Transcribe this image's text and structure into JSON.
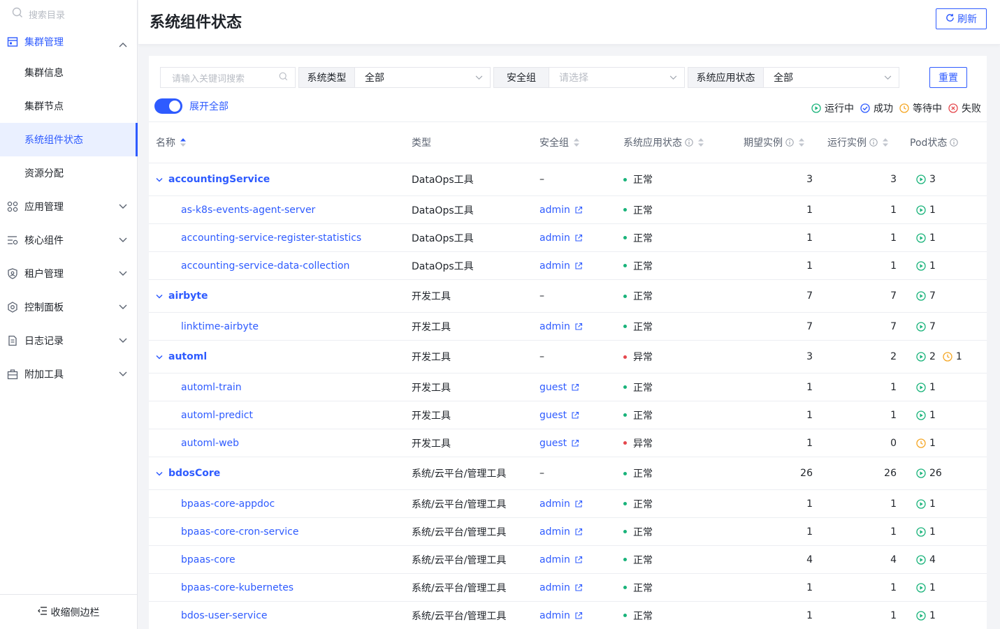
{
  "sidebar": {
    "search_placeholder": "搜索目录",
    "cluster_group": "集群管理",
    "sub_items": [
      "集群信息",
      "集群节点",
      "系统组件状态",
      "资源分配"
    ],
    "groups": [
      {
        "label": "应用管理",
        "icon": "apps-icon"
      },
      {
        "label": "核心组件",
        "icon": "core-components-icon"
      },
      {
        "label": "租户管理",
        "icon": "tenant-shield-icon"
      },
      {
        "label": "控制面板",
        "icon": "settings-gear-icon"
      },
      {
        "label": "日志记录",
        "icon": "log-document-icon"
      },
      {
        "label": "附加工具",
        "icon": "toolbox-icon"
      }
    ],
    "collapse_label": "收缩侧边栏"
  },
  "header": {
    "title": "系统组件状态",
    "refresh_label": "刷新"
  },
  "filters": {
    "keyword_placeholder": "请输入关键词搜索",
    "type_label": "系统类型",
    "type_value": "全部",
    "sg_label": "安全组",
    "sg_placeholder": "请选择",
    "status_label": "系统应用状态",
    "status_value": "全部",
    "reset_label": "重置",
    "expand_all_label": "展开全部"
  },
  "legend": {
    "running": "运行中",
    "success": "成功",
    "pending": "等待中",
    "failed": "失败"
  },
  "colors": {
    "accent": "#2e5bff",
    "running": "#19b37a",
    "success": "#2e5bff",
    "pending": "#f5a623",
    "failed": "#e5484d",
    "normal_dot": "#19b37a",
    "abnormal_dot": "#e5484d"
  },
  "table": {
    "columns": {
      "name": "名称",
      "type": "类型",
      "sg": "安全组",
      "status": "系统应用状态",
      "expected": "期望实例",
      "running": "运行实例",
      "pod": "Pod状态"
    },
    "rows": [
      {
        "kind": "parent",
        "name": "accountingService",
        "type": "DataOps工具",
        "sg": "–",
        "status": "正常",
        "ok": true,
        "expected": "3",
        "running": "3",
        "pods": [
          {
            "s": "running",
            "n": "3"
          }
        ]
      },
      {
        "kind": "child",
        "name": "as-k8s-events-agent-server",
        "type": "DataOps工具",
        "sg": "admin",
        "status": "正常",
        "ok": true,
        "expected": "1",
        "running": "1",
        "pods": [
          {
            "s": "running",
            "n": "1"
          }
        ]
      },
      {
        "kind": "child",
        "name": "accounting-service-register-statistics",
        "type": "DataOps工具",
        "sg": "admin",
        "status": "正常",
        "ok": true,
        "expected": "1",
        "running": "1",
        "pods": [
          {
            "s": "running",
            "n": "1"
          }
        ]
      },
      {
        "kind": "child",
        "name": "accounting-service-data-collection",
        "type": "DataOps工具",
        "sg": "admin",
        "status": "正常",
        "ok": true,
        "expected": "1",
        "running": "1",
        "pods": [
          {
            "s": "running",
            "n": "1"
          }
        ]
      },
      {
        "kind": "parent",
        "name": "airbyte",
        "type": "开发工具",
        "sg": "–",
        "status": "正常",
        "ok": true,
        "expected": "7",
        "running": "7",
        "pods": [
          {
            "s": "running",
            "n": "7"
          }
        ]
      },
      {
        "kind": "child",
        "name": "linktime-airbyte",
        "type": "开发工具",
        "sg": "admin",
        "status": "正常",
        "ok": true,
        "expected": "7",
        "running": "7",
        "pods": [
          {
            "s": "running",
            "n": "7"
          }
        ]
      },
      {
        "kind": "parent",
        "name": "automl",
        "type": "开发工具",
        "sg": "–",
        "status": "异常",
        "ok": false,
        "expected": "3",
        "running": "2",
        "pods": [
          {
            "s": "running",
            "n": "2"
          },
          {
            "s": "pending",
            "n": "1"
          }
        ]
      },
      {
        "kind": "child",
        "name": "automl-train",
        "type": "开发工具",
        "sg": "guest",
        "status": "正常",
        "ok": true,
        "expected": "1",
        "running": "1",
        "pods": [
          {
            "s": "running",
            "n": "1"
          }
        ]
      },
      {
        "kind": "child",
        "name": "automl-predict",
        "type": "开发工具",
        "sg": "guest",
        "status": "正常",
        "ok": true,
        "expected": "1",
        "running": "1",
        "pods": [
          {
            "s": "running",
            "n": "1"
          }
        ]
      },
      {
        "kind": "child",
        "name": "automl-web",
        "type": "开发工具",
        "sg": "guest",
        "status": "异常",
        "ok": false,
        "expected": "1",
        "running": "0",
        "pods": [
          {
            "s": "pending",
            "n": "1"
          }
        ]
      },
      {
        "kind": "parent",
        "name": "bdosCore",
        "type": "系统/云平台/管理工具",
        "sg": "–",
        "status": "正常",
        "ok": true,
        "expected": "26",
        "running": "26",
        "pods": [
          {
            "s": "running",
            "n": "26"
          }
        ]
      },
      {
        "kind": "child",
        "name": "bpaas-core-appdoc",
        "type": "系统/云平台/管理工具",
        "sg": "admin",
        "status": "正常",
        "ok": true,
        "expected": "1",
        "running": "1",
        "pods": [
          {
            "s": "running",
            "n": "1"
          }
        ]
      },
      {
        "kind": "child",
        "name": "bpaas-core-cron-service",
        "type": "系统/云平台/管理工具",
        "sg": "admin",
        "status": "正常",
        "ok": true,
        "expected": "1",
        "running": "1",
        "pods": [
          {
            "s": "running",
            "n": "1"
          }
        ]
      },
      {
        "kind": "child",
        "name": "bpaas-core",
        "type": "系统/云平台/管理工具",
        "sg": "admin",
        "status": "正常",
        "ok": true,
        "expected": "4",
        "running": "4",
        "pods": [
          {
            "s": "running",
            "n": "4"
          }
        ]
      },
      {
        "kind": "child",
        "name": "bpaas-core-kubernetes",
        "type": "系统/云平台/管理工具",
        "sg": "admin",
        "status": "正常",
        "ok": true,
        "expected": "1",
        "running": "1",
        "pods": [
          {
            "s": "running",
            "n": "1"
          }
        ]
      },
      {
        "kind": "child",
        "name": "bdos-user-service",
        "type": "系统/云平台/管理工具",
        "sg": "admin",
        "status": "正常",
        "ok": true,
        "expected": "1",
        "running": "1",
        "pods": [
          {
            "s": "running",
            "n": "1"
          }
        ]
      }
    ]
  }
}
